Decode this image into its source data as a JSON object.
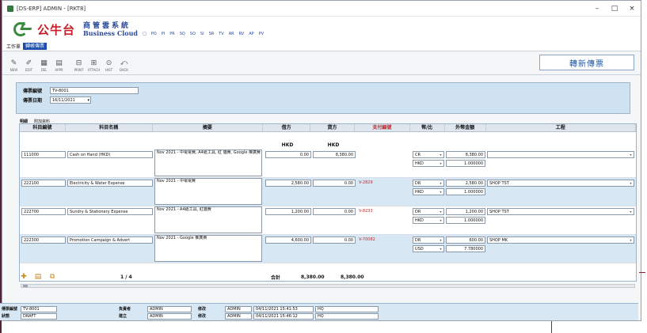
{
  "window": {
    "title": "[DS-ERP] ADMIN - [RKT8]",
    "minimize": "–",
    "maximize": "□",
    "close": "×"
  },
  "brand": {
    "name_cn": "公牛台",
    "sub_cn": "商管雲系統",
    "sub_en": "Business Cloud",
    "lang_links": [
      "□",
      "PO",
      "PI",
      "PR",
      "SQ",
      "SO",
      "SI",
      "SR",
      "TV",
      "AR",
      "RV",
      "AP",
      "PV"
    ]
  },
  "modules": [
    {
      "label": "工作單",
      "active": false
    },
    {
      "label": "轉帳傳票",
      "active": true
    }
  ],
  "toolbar": {
    "buttons": [
      {
        "icon": "new-icon",
        "glyph": "✎",
        "label": "NEW"
      },
      {
        "icon": "edit-icon",
        "glyph": "✐",
        "label": "EDIT"
      },
      {
        "icon": "delete-icon",
        "glyph": "▦",
        "label": "DEL"
      },
      {
        "icon": "approve-icon",
        "glyph": "▤",
        "label": "APPR"
      },
      {
        "icon": "print-icon",
        "glyph": "⊟",
        "label": "PRINT"
      },
      {
        "icon": "attach-icon",
        "glyph": "⊞",
        "label": "ATTACH"
      },
      {
        "icon": "history-icon",
        "glyph": "⊙",
        "label": "HIST"
      },
      {
        "icon": "back-icon",
        "glyph": "⤺",
        "label": "BACK"
      }
    ],
    "refresh_label": "轉新傳票"
  },
  "header": {
    "doc_no_label": "傳票編號",
    "doc_no_value": "TV-8001",
    "doc_date_label": "傳票日期",
    "doc_date_value": "16/11/2021"
  },
  "detail_tabs": [
    "明細",
    "附加資料"
  ],
  "grid": {
    "columns": [
      "科目編號",
      "科目名稱",
      "摘要",
      "借方",
      "貸方",
      "支付編號",
      "幣/比",
      "外幣金額",
      "工程"
    ],
    "currency_debit": "HKD",
    "currency_credit": "HKD",
    "rows": [
      {
        "acct_no": "111000",
        "acct_name": "Cash on Hand (HKD)",
        "desc": "Nov 2021 - 中電電費, A4紙工具, 紅 貓費, Google 推廣費",
        "debit": "0.00",
        "credit": "8,380.00",
        "pay_no": "",
        "dc": "CR",
        "cur": "HKD",
        "fx_amount": "8,380.00",
        "rate": "1.000000",
        "project": ""
      },
      {
        "acct_no": "222100",
        "acct_name": "Electricity & Water Expense",
        "desc": "Nov 2021 - 中電電費",
        "debit": "2,580.00",
        "credit": "0.00",
        "pay_no": "V-2829",
        "dc": "DR",
        "cur": "HKD",
        "fx_amount": "2,580.00",
        "rate": "1.000000",
        "project": "SHOP TST"
      },
      {
        "acct_no": "222700",
        "acct_name": "Sundry & Stationery Expense",
        "desc": "Nov 2021 - A4紙工具, 紅貓費",
        "debit": "1,200.00",
        "credit": "0.00",
        "pay_no": "V-8233",
        "dc": "DR",
        "cur": "HKD",
        "fx_amount": "1,200.00",
        "rate": "1.000000",
        "project": "SHOP TST"
      },
      {
        "acct_no": "222300",
        "acct_name": "Promotion Campaign & Advert",
        "desc": "Nov 2021 - Google 推廣費",
        "debit": "4,600.00",
        "credit": "0.00",
        "pay_no": "V-70082",
        "dc": "DR",
        "cur": "USD",
        "fx_amount": "600.00",
        "rate": "7.780000",
        "project": "SHOP MK"
      }
    ],
    "pager": "1 / 4",
    "total_label": "合計",
    "total_debit": "8,380.00",
    "total_credit": "8,380.00"
  },
  "status": {
    "doc_no_label": "傳票編號",
    "doc_no_value": "TV-8001",
    "status_label": "狀態",
    "status_value": "DRAFT",
    "owner_label": "負責者",
    "owner_value": "ADMIN",
    "creator_label": "建立",
    "creator_value": "ADMIN",
    "create_label": "修改",
    "create_user": "ADMIN",
    "create_time": "04/11/2021 15:41:53",
    "create_loc": "HQ",
    "modify_label": "修改",
    "modify_user": "ADMIN",
    "modify_time": "04/11/2021 15:46:12",
    "modify_loc": "HQ"
  }
}
